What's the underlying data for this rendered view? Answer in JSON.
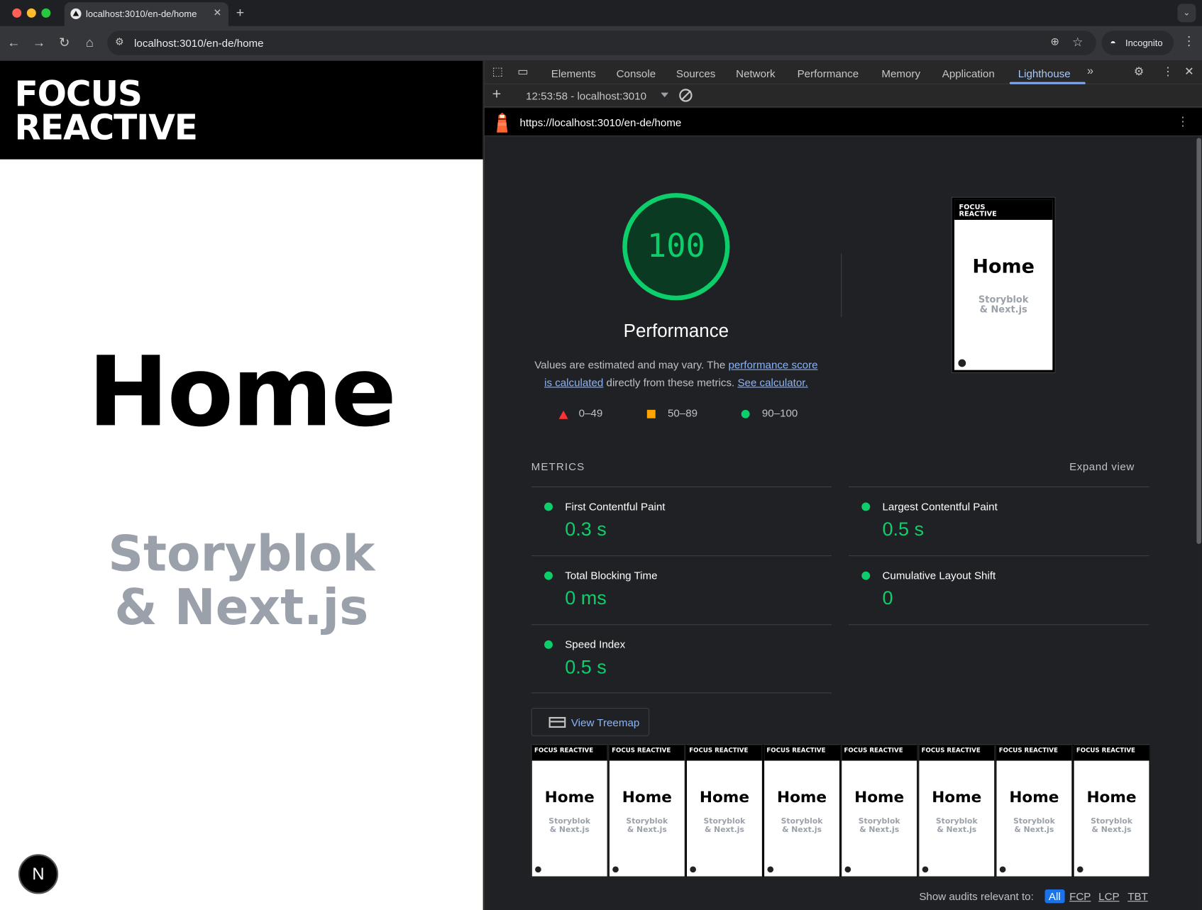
{
  "browser": {
    "tab_title": "localhost:3010/en-de/home",
    "address": "localhost:3010/en-de/home",
    "incognito_label": "Incognito"
  },
  "page": {
    "logo_line1": "FOCUS",
    "logo_line2": "REACTIVE",
    "title": "Home",
    "subtitle_line1": "Storyblok",
    "subtitle_line2": "& Next.js",
    "badge": "N"
  },
  "devtools": {
    "tabs": [
      "Elements",
      "Console",
      "Sources",
      "Network",
      "Performance",
      "Memory",
      "Application",
      "Lighthouse"
    ],
    "active_tab": "Lighthouse",
    "report_selector": "12:53:58 - localhost:3010",
    "report_url": "https://localhost:3010/en-de/home"
  },
  "lighthouse": {
    "score": "100",
    "category": "Performance",
    "desc_prefix": "Values are estimated and may vary. The ",
    "desc_link1": "performance score is calculated",
    "desc_mid": " directly from these metrics. ",
    "desc_link2": "See calculator.",
    "legend": [
      "0–49",
      "50–89",
      "90–100"
    ],
    "metrics_title": "METRICS",
    "expand_label": "Expand view",
    "metrics": [
      {
        "name": "First Contentful Paint",
        "value": "0.3 s"
      },
      {
        "name": "Largest Contentful Paint",
        "value": "0.5 s"
      },
      {
        "name": "Total Blocking Time",
        "value": "0 ms"
      },
      {
        "name": "Cumulative Layout Shift",
        "value": "0"
      },
      {
        "name": "Speed Index",
        "value": "0.5 s"
      }
    ],
    "treemap_label": "View Treemap",
    "filter_label": "Show audits relevant to:",
    "filters": [
      "All",
      "FCP",
      "LCP",
      "TBT"
    ],
    "thumb_logo": "FOCUS REACTIVE",
    "thumb_title": "Home",
    "thumb_sub1": "Storyblok",
    "thumb_sub2": "& Next.js"
  },
  "colors": {
    "pass": "#0cce6b",
    "average": "#ffa400",
    "fail": "#ff3333",
    "link": "#8ab4f8"
  }
}
